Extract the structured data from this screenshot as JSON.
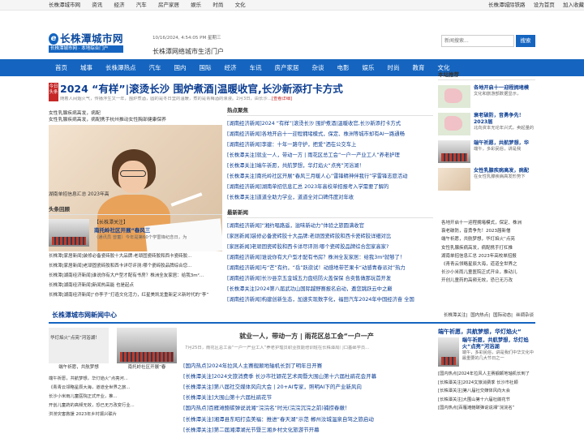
{
  "topbar": {
    "nav": [
      "长株潭城市网",
      "资讯",
      "经济",
      "汽车",
      "房产家居",
      "娱乐",
      "时尚",
      "文化"
    ],
    "right": [
      "长株潭城际铁路",
      "设为首页",
      "加入收藏"
    ]
  },
  "header": {
    "logo_name": "长株潭城市网",
    "logo_slogan": "长株潭城市网 · 本地综合门户",
    "date": "10/16/2024, 4:54:05 PM 星期三",
    "slogan": "长株潭网络城市生活门户",
    "search_placeholder": "新闻搜索...",
    "search_button": "搜索"
  },
  "nav": [
    "首页",
    "城事",
    "长株潭热点",
    "汽车",
    "国内",
    "国际",
    "经济",
    "车讯",
    "房产家居",
    "杂谈",
    "电影",
    "娱乐",
    "时尚",
    "教育",
    "文化"
  ],
  "lead": {
    "badge": "今日头条",
    "title": "2024 “有样”|滚烫长沙 围炉煮酒|温暖收官,长沙新添打卡方式",
    "summary": "随着人间烟火气，传播浮生又一年，围炉煮酒，圆的是冬日里的温暖，煮的是青梅酒的浪漫。2月3日，由长沙...",
    "more": "[查看详细]"
  },
  "photo": {
    "caption1": "女性乳腺疾病高发，病配",
    "caption2": "女性乳腺疾病高发，病配携手杭州推动女性胸部健康保养",
    "caption3": "湖南单招信息汇总 2023年高"
  },
  "hot": {
    "title": "热点聚焦",
    "items": [
      "[湖南经济新闻]2024 “有样”|滚烫长沙 围炉煮酒|温暖收官,长沙新添打卡方式",
      "[湖南经济新闻]各地开启十一迎程拥堵模式，保定、株洲等城市却有AI一路通畅",
      "[湖南经济新闻]李建：十年一路守护，把爱“洒在公交车上",
      "[长株潭关注]就业一人，带动一方 | 雨花区总工会“一户一产业工人”养老护理",
      "[长株潭关注]端午祈愿，共航梦想，华灯焰火“点亮”河浴湖！",
      "[长株潭关注]南托岭社区开展“春风三月暖人心”雷锋精神伴我行”学雷锋志愿活动",
      "[湖南经济新闻]湖南单招信息汇总 2023年高校单招报考入学需要了解的",
      "[长株潭关注]道道全助力学业，道道全对口碑伟度对年收"
    ]
  },
  "latest": {
    "title": "最新新闻",
    "items": [
      "[湖南经济新闻]“湘约唱路遥，滋味新动力”体验之旅圆满收官",
      "[家居新闻]装修必备瓷砖胶十大品牌:老顽固瓷砖胶和西卡瓷砖胶详细对比",
      "[家居新闻]老顽固瓷砖胶和西卡详尽评测:哪个瓷砖胶品牌综合您家高家?",
      "[湖南经济新闻]谁说你有大户型才配有书房？株洲全友家居：给我3m²就够了！",
      "[湖南经济新闻]与“芒”有约，“岳”跃欲试！动感地带芒果卡“动感青春派对”热力",
      "[湖南经济新闻]长沙县京五金城五力盘结防火盖保保 合卖售做那玩首开发",
      "[长株潭关注]2024第八届武功山国际越野赛报名启动，邀您跳跃云中之巅",
      "[湖南经济新闻]构建创新生态，加速实现数字化，福田汽车2024年中国经济奋 全国"
    ]
  },
  "headline": {
    "title": "头条回顾",
    "tag": "【长株潭关注】",
    "sub_title": "南托岭社区开展“春风三",
    "desc": "（通讯员 曾童）今年是第60个学雷锋纪念日，为",
    "items": [
      "长株潭[家居新闻]装修必备瓷砖胶十大品牌:老顽固瓷砖胶和西卡瓷砖胶...",
      "长株潭[家居新闻]老顽固瓷砖胶和西卡详尽评测:哪个瓷砖胶品牌综合您...",
      "长株潭[湖南经济新闻]谁说你有大户型才配有书房？株洲全友家居：给我3m²...",
      "长株潭[湖南经济新闻]新闻热高能 也是起点",
      "长株潭[湖南经济新闻]“亦李子”打造文化活力，红星美凯龙重新定义新时代的“李”"
    ]
  },
  "recommend": {
    "title": "本站推荐",
    "items": [
      {
        "title": "各地开启十一迎程拥堵模",
        "desc": "文化和旅游部数据显示，"
      },
      {
        "title": "衰老破防，音勇争先！2023届",
        "desc": "北向资本无论年兴式，卖起量的"
      },
      {
        "title": "端午祈愿，共航梦想，华",
        "desc": "端午，多彩民俗，讲是我"
      },
      {
        "title": "女性乳腺疾病高发，病配",
        "desc": "在女性乳腺疾病高发形势下"
      }
    ],
    "list": [
      "各地开启十一迎程拥堵模式，保定、株洲",
      "衰老破防，音勇争先！2023届新僧",
      "端午祈愿，共航梦想，华灯焰火“点亮",
      "女性乳腺疾病高发，病配携手打杠推",
      "湖南单招信息汇总 2023年高校单招报",
      "《青青云领略星辰大海，道道全世界之",
      "长沙小米雨儿童医院正式开业，推动儿",
      "开创儿童药的高频无效，恐已无万改"
    ]
  },
  "news_center": {
    "title": "长株潭城市网新闻中心",
    "links": [
      "长株潭关注",
      "国内热点",
      "国际动态",
      "丝绸杂谈"
    ]
  },
  "thumbs": {
    "items": [
      {
        "caption": "端午祈愿，共航梦想"
      },
      {
        "caption": "南托岭社区开展“春"
      }
    ],
    "over_text": "华灯焰火“点亮”河浴湖！",
    "list": [
      "端午祈愿，共航梦想，华灯焰火“点亮河...",
      "《青青云领略星辰大海，道道全世界之旅...",
      "长沙小米雨儿童医院正式开业，推...",
      "开创儿童药的高频无效，恐已无万改变行业...",
      "洪涝灾害救援 2023年乡村振兴联片"
    ]
  },
  "center": {
    "headline": "就业一人，带动一方 | 雨花区总工会“一户一产",
    "summary": "7月25日，雨花区总工会“一户一产业工人”养老护理员职业技能培训班在长株潭局门口基础学员...",
    "items": [
      "[国内热点]2024年拉风人主赛舰颠地轴机长到了明年日开赛",
      "[长株潭关注]2024文旅消费季 长沙市社颖花艺术周暨大围山第十六届杜鹃花会开幕",
      "[长株潭关注]第八届社交媒体风向大会 | 20+AI专家，照明AI下的产业新风向",
      "[长株潭关注]大围山第十六届杜鹃花节",
      "[国内热点]百雁滩鲍碳弹说说湘“浣浣名”时光(浣浣沉浣之前)捕捞春嫩！",
      "[长株潭关注]湘潭县东昭打造美福：推进“春天湖”示范 郴州汝城温泉自驾之旅启动",
      "[长株潭关注]第二届湘潭湖光节暨三湘乡村文化旅游节开幕",
      "[国内热点]湘潭鲍碳弹说说湘“浣浣名”“浣浣名”之旅"
    ]
  },
  "side2": {
    "title": "端午祈愿，共航梦想，华灯焰火“",
    "item_title": "端午祈愿，共航梦想，华灯焰火“点亮”河浴湖",
    "item_desc": "端午，多彩民俗，讲是我们中华文化中最重要的几大节日之一",
    "list": [
      "[国内热点]2024年拉风人主赛舰颠地轴机长到了",
      "[长株潭关注]2024文旅消费季 长沙市社颖",
      "[长株潭关注]第八届社交媒体风向大会",
      "[长株潭关注]大围山第十六届杜鹃花节",
      "[国内热点]百雁滩鲍碳弹说说湘“浣浣名”"
    ]
  }
}
